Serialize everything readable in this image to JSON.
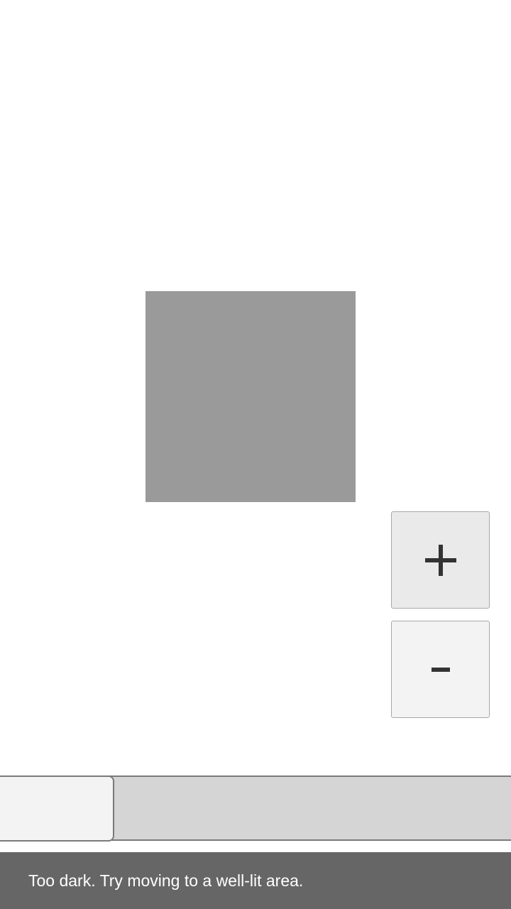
{
  "camera": {
    "zoom_in_icon": "plus-icon",
    "zoom_out_icon": "minus-icon",
    "preview_color": "#9a9a9a"
  },
  "toast": {
    "message": "Too dark. Try moving to a well-lit area."
  }
}
